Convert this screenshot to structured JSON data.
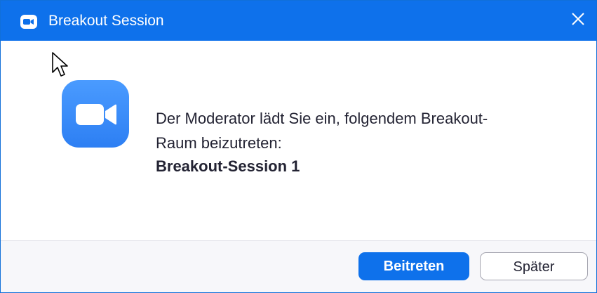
{
  "window": {
    "title": "Breakout Session",
    "title_icon": "zoom-camera-icon",
    "close_icon": "close-icon"
  },
  "content": {
    "app_icon": "zoom-camera-icon",
    "message": "Der Moderator lädt Sie ein, folgendem Breakout-Raum beizutreten:",
    "message_line1": "Der Moderator lädt Sie ein, folgendem Breakout-",
    "message_line2": "Raum beizutreten:",
    "session_name": "Breakout-Session 1"
  },
  "buttons": {
    "join_label": "Beitreten",
    "later_label": "Später"
  },
  "colors": {
    "accent": "#0e71eb",
    "text": "#232333",
    "footer_bg": "#f7f7fa"
  }
}
